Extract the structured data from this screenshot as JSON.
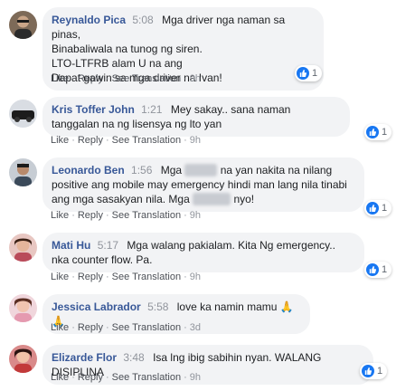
{
  "like_label": "Like",
  "reply_label": "Reply",
  "see_translation_label": "See Translation",
  "separator": "·",
  "comments": [
    {
      "name": "Reynaldo Pica",
      "time": "5:08",
      "lines": [
        "Mga driver nga naman sa pinas,",
        "Binabaliwala na tunog ng siren.",
        "LTO-LTFRB alam U na ang",
        "Dapat gawin sa mga driver na Ivan!"
      ],
      "reactions": "1",
      "age": "9h"
    },
    {
      "name": "Kris Toffer John",
      "time": "1:21",
      "text": "Mey sakay.. sana naman tanggalan na ng lisensya ng lto yan",
      "reactions": "1",
      "age": "9h"
    },
    {
      "name": "Leonardo Ben",
      "time": "1:56",
      "text_a": "Mga",
      "text_b": "na yan nakita na nilang positive ang mobile may emergency hindi man lang nila tinabi ang mga sasakyan nila. Mga",
      "text_c": "nyo!",
      "reactions": "1",
      "age": "9h"
    },
    {
      "name": "Mati Hu",
      "time": "5:17",
      "text": "Mga walang pakialam. Kita Ng emergency.. nka counter flow. Pa.",
      "reactions": "1",
      "age": "9h"
    },
    {
      "name": "Jessica Labrador",
      "time": "5:58",
      "text": "love ka namin mamu",
      "emoji": "🙏🙏",
      "age": "3d"
    },
    {
      "name": "Elizarde Flor",
      "time": "3:48",
      "text": "Isa lng ibig sabihin nyan. WALANG DISIPLINA",
      "reactions": "1",
      "age": "9h"
    }
  ]
}
